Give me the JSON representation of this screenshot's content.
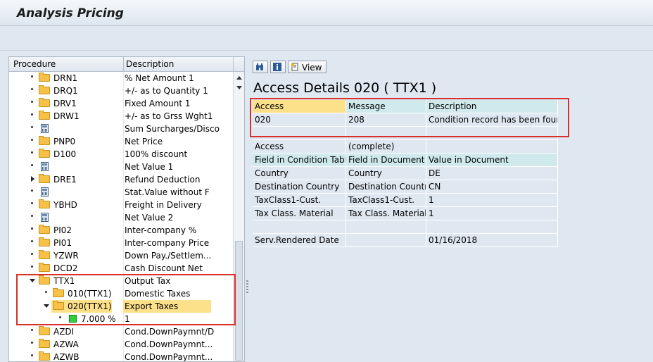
{
  "window": {
    "title": "Analysis Pricing"
  },
  "tree": {
    "headers": {
      "procedure": "Procedure",
      "description": "Description"
    },
    "rows": [
      {
        "code": "DRN1",
        "desc": "% Net Amount 1",
        "icon": "folder"
      },
      {
        "code": "DRQ1",
        "desc": "+/- as to Quantity 1",
        "icon": "folder"
      },
      {
        "code": "DRV1",
        "desc": "Fixed Amount 1",
        "icon": "folder"
      },
      {
        "code": "DRW1",
        "desc": "+/- as to Grss Wght1",
        "icon": "folder"
      },
      {
        "code": "",
        "desc": "Sum Surcharges/Disco",
        "icon": "calculator"
      },
      {
        "code": "PNP0",
        "desc": "Net Price",
        "icon": "folder"
      },
      {
        "code": "D100",
        "desc": "100% discount",
        "icon": "folder"
      },
      {
        "code": "",
        "desc": "Net Value 1",
        "icon": "calculator"
      },
      {
        "code": "DRE1",
        "desc": "Refund Deduction",
        "icon": "folder"
      },
      {
        "code": "",
        "desc": "Stat.Value without F",
        "icon": "calculator"
      },
      {
        "code": "YBHD",
        "desc": "Freight in Delivery",
        "icon": "folder"
      },
      {
        "code": "",
        "desc": "Net Value 2",
        "icon": "calculator"
      },
      {
        "code": "PI02",
        "desc": "Inter-company %",
        "icon": "folder"
      },
      {
        "code": "PI01",
        "desc": "Inter-company Price",
        "icon": "folder"
      },
      {
        "code": "YZWR",
        "desc": "Down Pay./Settlem...",
        "icon": "folder"
      },
      {
        "code": "DCD2",
        "desc": "Cash Discount Net",
        "icon": "folder"
      },
      {
        "code": "TTX1",
        "desc": "Output Tax",
        "icon": "folder-open"
      },
      {
        "code": "010(TTX1)",
        "desc": "Domestic Taxes",
        "icon": "folder"
      },
      {
        "code": "020(TTX1)",
        "desc": "Export Taxes",
        "icon": "folder-open"
      },
      {
        "code": "7.000 %",
        "desc": "1",
        "icon": "green-square"
      },
      {
        "code": "AZDI",
        "desc": "Cond.DownPaymnt/D",
        "icon": "folder"
      },
      {
        "code": "AZWA",
        "desc": "Cond.DownPaymnt...",
        "icon": "folder"
      },
      {
        "code": "AZWB",
        "desc": "Cond.DownPaymnt...",
        "icon": "folder"
      }
    ]
  },
  "details": {
    "toolbar": {
      "view_label": "View"
    },
    "title": "Access Details 020 ( TTX1 )",
    "top_table": {
      "headers": [
        "Access",
        "Message",
        "Description"
      ],
      "row": [
        "020",
        "208",
        "Condition record has been found"
      ]
    },
    "access_row": [
      "Access",
      "(complete)",
      ""
    ],
    "field_headers": [
      "Field in Condition Table",
      "Field in Document",
      "Value in Document"
    ],
    "fields": [
      [
        "Country",
        "Country",
        "DE"
      ],
      [
        "Destination Country",
        "Destination Country",
        "CN"
      ],
      [
        "TaxClass1-Cust.",
        "TaxClass1-Cust.",
        "1"
      ],
      [
        "Tax Class. Material",
        "Tax Class. Material",
        "1"
      ]
    ],
    "service_row": [
      "Serv.Rendered Date",
      "",
      "01/16/2018"
    ]
  },
  "colors": {
    "highlight": "#fce08a",
    "header_teal": "#cfe9ec",
    "red_box": "#d9302b"
  }
}
